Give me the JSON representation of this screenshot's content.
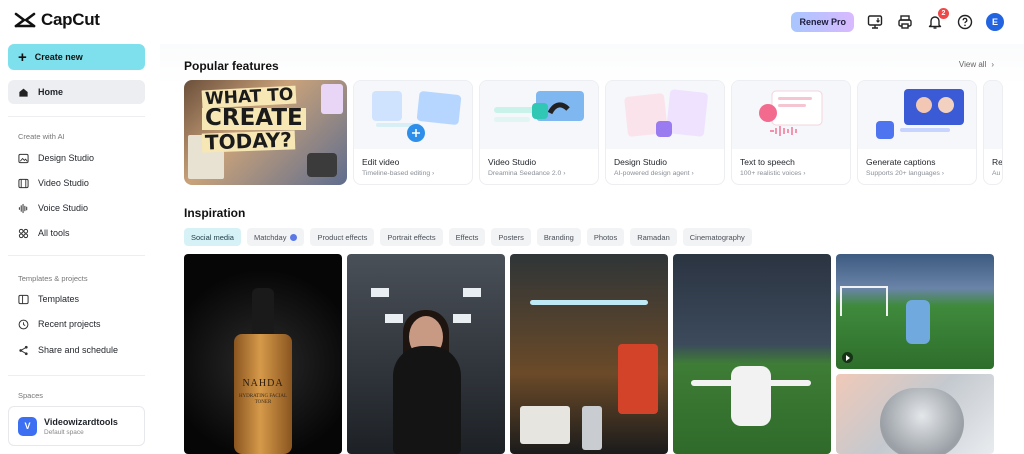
{
  "app": {
    "name": "CapCut"
  },
  "header": {
    "renew_label": "Renew Pro",
    "notification_count": "2",
    "avatar_letter": "E",
    "icons": [
      "monitor-download-icon",
      "printer-icon",
      "bell-icon",
      "help-icon"
    ]
  },
  "sidebar": {
    "create_label": "Create new",
    "home_label": "Home",
    "ai_section": "Create with AI",
    "ai_items": [
      "Design Studio",
      "Video Studio",
      "Voice Studio",
      "All tools"
    ],
    "tp_section": "Templates & projects",
    "tp_items": [
      "Templates",
      "Recent projects",
      "Share and schedule"
    ],
    "spaces_section": "Spaces",
    "space": {
      "badge": "V",
      "name": "Videowizardtools",
      "sub": "Default space"
    }
  },
  "popular": {
    "title": "Popular features",
    "view_all": "View all",
    "hero_text": {
      "l1": "WHAT TO",
      "l2": "CREATE",
      "l3": "TODAY?"
    },
    "cards": [
      {
        "name": "Edit video",
        "sub": "Timeline-based editing"
      },
      {
        "name": "Video Studio",
        "sub": "Dreamina Seedance 2.0"
      },
      {
        "name": "Design Studio",
        "sub": "AI-powered design agent"
      },
      {
        "name": "Text to speech",
        "sub": "100+ realistic voices"
      },
      {
        "name": "Generate captions",
        "sub": "Supports 20+ languages"
      },
      {
        "name": "Re",
        "sub": "Au"
      }
    ]
  },
  "inspiration": {
    "title": "Inspiration",
    "chips": [
      "Social media",
      "Matchday",
      "Product effects",
      "Portrait effects",
      "Effects",
      "Posters",
      "Branding",
      "Photos",
      "Ramadan",
      "Cinematography"
    ],
    "bottle_label": "NAHDA",
    "bottle_sub": "HYDRATING FACIAL TONER"
  },
  "colors": {
    "accent": "#7ee0ec",
    "active_chip": "#d6f2f7",
    "badge": "#f04848",
    "avatar": "#2163e0"
  }
}
